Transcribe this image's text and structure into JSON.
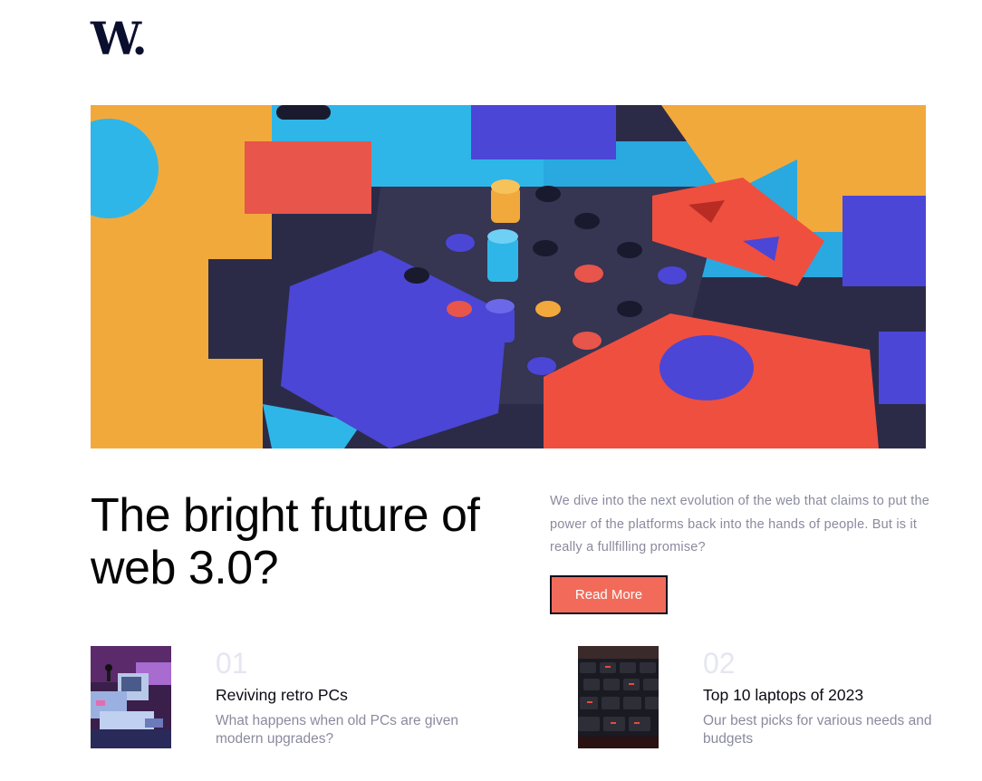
{
  "brand": {
    "logo_text": "W."
  },
  "hero": {
    "headline": "The bright future of web 3.0?",
    "excerpt": "We dive into the next evolution of the web that claims to put the power of the platforms back into the hands of people. But is it really a fullfilling promise?",
    "read_more_label": "Read More",
    "accent_color": "#f26b5a"
  },
  "articles": [
    {
      "number": "01",
      "title": "Reviving retro PCs",
      "description": "What happens when old PCs are given modern upgrades?"
    },
    {
      "number": "02",
      "title": "Top 10 laptops of 2023",
      "description": "Our best picks for various needs and budgets"
    }
  ]
}
